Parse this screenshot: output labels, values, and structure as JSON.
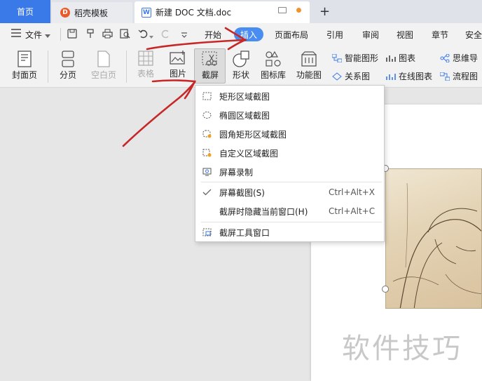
{
  "tabs": {
    "home": "首页",
    "template": "稻壳模板",
    "document": "新建 DOC 文档.doc",
    "doc_icon": "W",
    "template_icon": "D",
    "new_tab": "+"
  },
  "menu": {
    "file": "文件",
    "items": [
      "开始",
      "插入",
      "页面布局",
      "引用",
      "审阅",
      "视图",
      "章节",
      "安全"
    ],
    "active": "插入"
  },
  "ribbon": {
    "cover_page": "封面页",
    "page_break": "分页",
    "blank_page": "空白页",
    "table": "表格",
    "picture": "图片",
    "screenshot": "截屏",
    "shapes": "形状",
    "icon_library": "图标库",
    "function_chart": "功能图",
    "smart_art": "智能图形",
    "chart": "图表",
    "relation_chart": "关系图",
    "online_chart": "在线图表",
    "mind_map": "思维导",
    "flowchart": "流程图"
  },
  "screenshot_menu": {
    "items": [
      {
        "label": "矩形区域截图",
        "icon": "rect-dashed-icon"
      },
      {
        "label": "椭圆区域截图",
        "icon": "ellipse-dashed-icon"
      },
      {
        "label": "圆角矩形区域截图",
        "icon": "rounded-rect-icon"
      },
      {
        "label": "自定义区域截图",
        "icon": "custom-region-icon"
      },
      {
        "label": "屏幕录制",
        "icon": "record-icon"
      },
      {
        "label": "屏幕截图(S)",
        "shortcut": "Ctrl+Alt+X",
        "checked": true
      },
      {
        "label": "截屏时隐藏当前窗口(H)",
        "shortcut": "Ctrl+Alt+C"
      },
      {
        "label": "截屏工具窗口",
        "icon": "tool-window-icon"
      }
    ]
  },
  "watermark": "软件技巧",
  "colors": {
    "accent": "#3a7ae8",
    "pill": "#4a8df0",
    "annotation": "#c62828",
    "orange_dot": "#f0932b"
  }
}
